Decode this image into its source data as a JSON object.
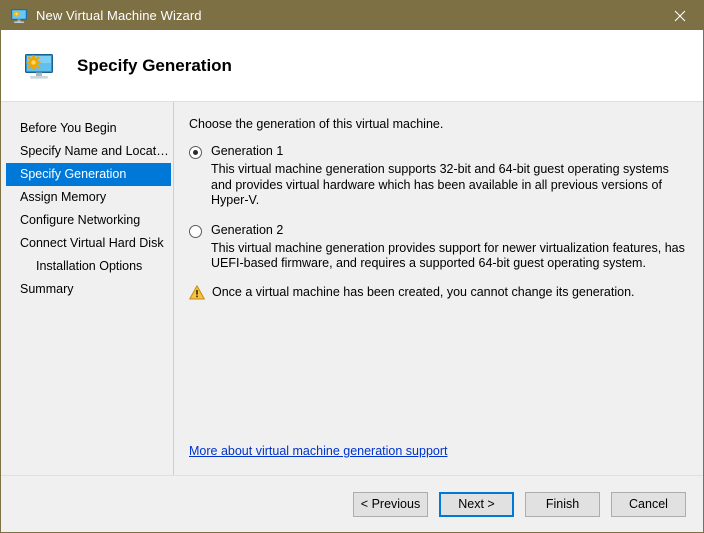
{
  "window": {
    "title": "New Virtual Machine Wizard",
    "titlebar_color": "#7d7044",
    "close_icon": "close-icon"
  },
  "header": {
    "title": "Specify Generation",
    "icon": "virtual-machine-monitor-icon"
  },
  "sidebar": {
    "items": [
      {
        "label": "Before You Begin",
        "selected": false,
        "indent": false
      },
      {
        "label": "Specify Name and Location",
        "selected": false,
        "indent": false
      },
      {
        "label": "Specify Generation",
        "selected": true,
        "indent": false
      },
      {
        "label": "Assign Memory",
        "selected": false,
        "indent": false
      },
      {
        "label": "Configure Networking",
        "selected": false,
        "indent": false
      },
      {
        "label": "Connect Virtual Hard Disk",
        "selected": false,
        "indent": false
      },
      {
        "label": "Installation Options",
        "selected": false,
        "indent": true
      },
      {
        "label": "Summary",
        "selected": false,
        "indent": false
      }
    ],
    "selection_color": "#0078d7"
  },
  "main": {
    "intro": "Choose the generation of this virtual machine.",
    "options": [
      {
        "label": "Generation 1",
        "checked": true,
        "description": "This virtual machine generation supports 32-bit and 64-bit guest operating systems and provides virtual hardware which has been available in all previous versions of Hyper-V."
      },
      {
        "label": "Generation 2",
        "checked": false,
        "description": "This virtual machine generation provides support for newer virtualization features, has UEFI-based firmware, and requires a supported 64-bit guest operating system."
      }
    ],
    "warning": {
      "icon": "warning-triangle-icon",
      "text": "Once a virtual machine has been created, you cannot change its generation.",
      "color": "#f0ad22"
    },
    "link": {
      "text": "More about virtual machine generation support",
      "color": "#0033cc"
    }
  },
  "footer": {
    "buttons": [
      {
        "label": "< Previous",
        "focused": false
      },
      {
        "label": "Next >",
        "focused": true
      },
      {
        "label": "Finish",
        "focused": false
      },
      {
        "label": "Cancel",
        "focused": false
      }
    ],
    "focus_color": "#0078d7"
  }
}
